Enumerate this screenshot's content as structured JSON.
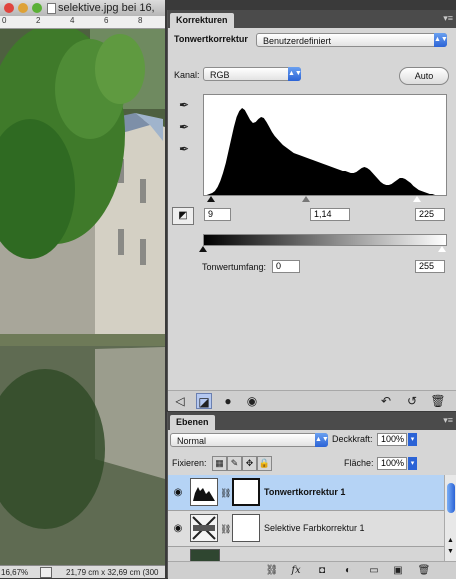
{
  "document": {
    "title": "selektive.jpg bei 16,",
    "ruler_ticks": [
      "0",
      "2",
      "4",
      "6",
      "8"
    ],
    "zoom": "16,67%",
    "size_info": "21,79 cm x 32,69 cm (300"
  },
  "korrekturen": {
    "tab_label": "Korrekturen",
    "menu_glyph": "▾≡",
    "adjustment_name": "Tonwertkorrektur",
    "preset_value": "Benutzerdefiniert",
    "kanal_label": "Kanal:",
    "kanal_value": "RGB",
    "auto_label": "Auto",
    "input_black": "9",
    "input_gamma": "1,14",
    "input_white": "225",
    "output_label": "Tonwertumfang:",
    "output_black": "0",
    "output_white": "255",
    "histogram": [
      0,
      0,
      1,
      2,
      4,
      8,
      14,
      22,
      32,
      44,
      56,
      68,
      78,
      84,
      87,
      85,
      80,
      75,
      72,
      73,
      76,
      78,
      77,
      73,
      68,
      63,
      59,
      56,
      53,
      50,
      48,
      46,
      44,
      42,
      41,
      40,
      39,
      38,
      37,
      36,
      35,
      34,
      33,
      32,
      31,
      30,
      29,
      28,
      27,
      26,
      25,
      24,
      24,
      23,
      22,
      22,
      23,
      25,
      27,
      28,
      27,
      25,
      22,
      19,
      16,
      13,
      11,
      10,
      10,
      11,
      13,
      15,
      17,
      17,
      16,
      14,
      12,
      9,
      7,
      5,
      4,
      3,
      2,
      1,
      1,
      0,
      0,
      0,
      0,
      0
    ]
  },
  "ebenen": {
    "tab_label": "Ebenen",
    "menu_glyph": "▾≡",
    "blend_mode": "Normal",
    "opacity_label": "Deckkraft:",
    "opacity_value": "100%",
    "lock_label": "Fixieren:",
    "fill_label": "Fläche:",
    "fill_value": "100%",
    "layers": [
      {
        "name": "Tonwertkorrektur 1"
      },
      {
        "name": "Selektive Farbkorrektur 1"
      }
    ]
  },
  "colors": {
    "selection": "#b5d3f5",
    "panel_bg": "#d6d6d6",
    "accent": "#2b63d6"
  }
}
